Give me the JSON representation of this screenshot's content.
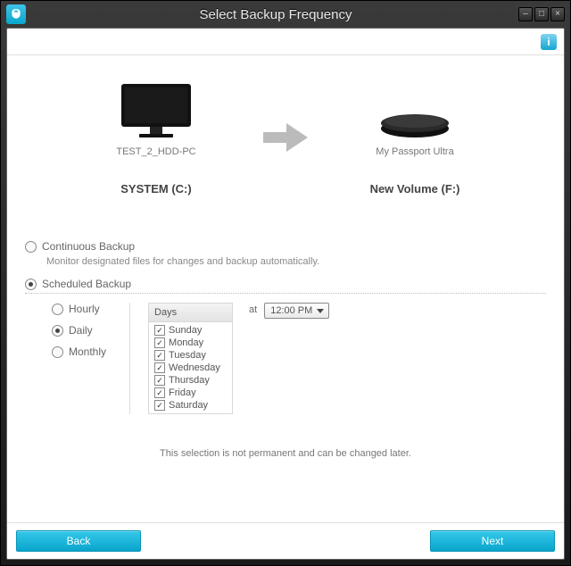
{
  "window": {
    "title": "Select Backup Frequency"
  },
  "source": {
    "name": "TEST_2_HDD-PC",
    "drive": "SYSTEM (C:)"
  },
  "target": {
    "name": "My Passport Ultra",
    "drive": "New Volume (F:)"
  },
  "continuous": {
    "label": "Continuous Backup",
    "desc": "Monitor designated files for changes and backup automatically."
  },
  "scheduled": {
    "label": "Scheduled Backup"
  },
  "freq": {
    "hourly": "Hourly",
    "daily": "Daily",
    "monthly": "Monthly"
  },
  "days_header": "Days",
  "days": [
    "Sunday",
    "Monday",
    "Tuesday",
    "Wednesday",
    "Thursday",
    "Friday",
    "Saturday"
  ],
  "at": "at",
  "time": "12:00 PM",
  "note": "This selection is not permanent and can be changed later.",
  "buttons": {
    "back": "Back",
    "next": "Next"
  }
}
